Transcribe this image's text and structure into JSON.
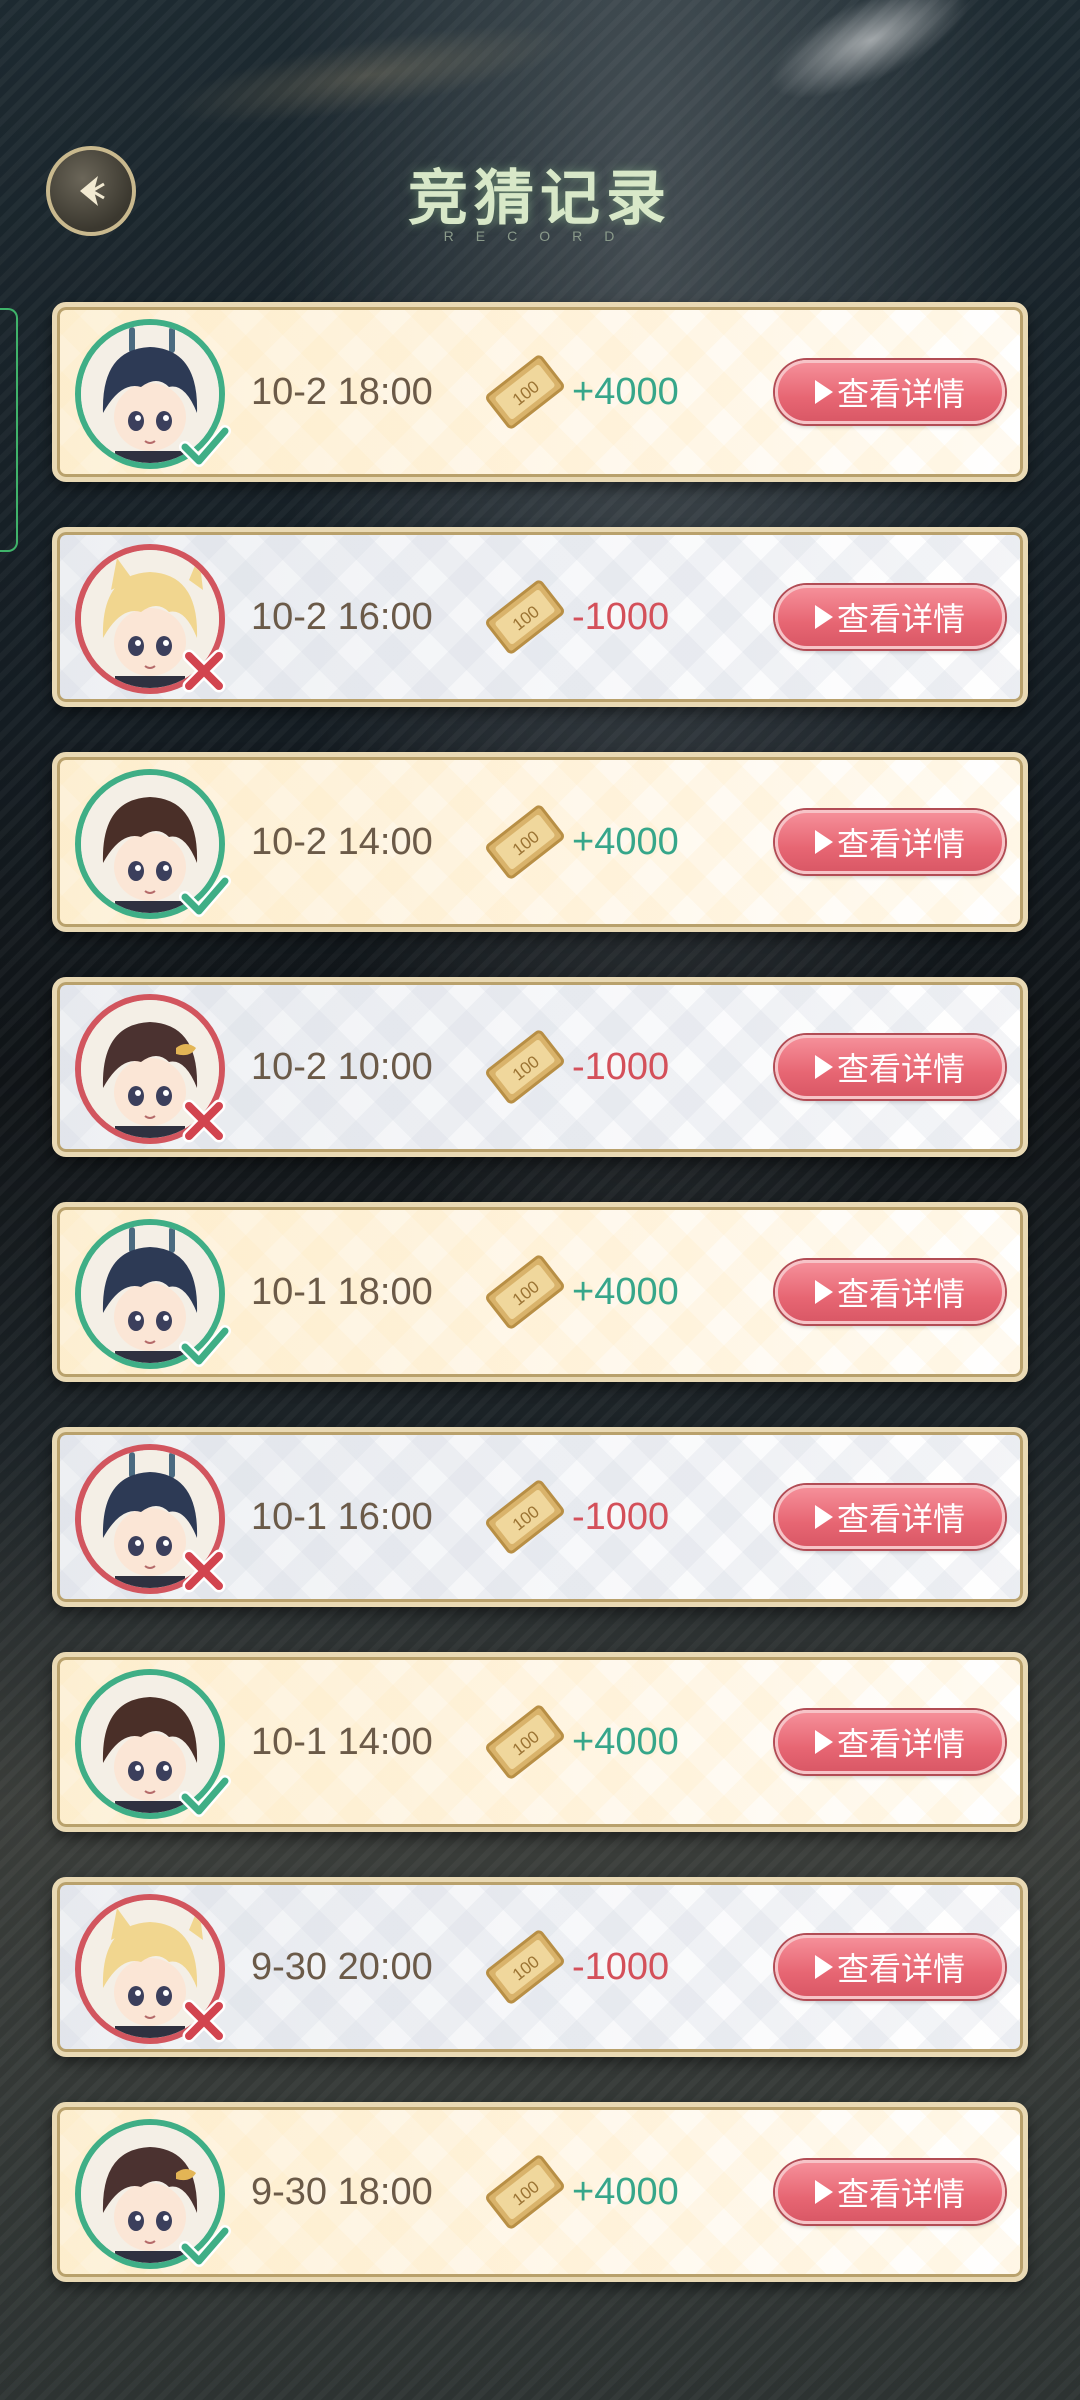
{
  "header": {
    "title": "竞猜记录",
    "subtitle": "RECORD"
  },
  "icons": {
    "back": "back-arrow-icon",
    "coin": "ticket-100-icon",
    "win": "checkmark-icon",
    "loss": "cross-icon"
  },
  "colors": {
    "win": "#36a68a",
    "loss": "#d4505a",
    "button": "#e76673"
  },
  "records": [
    {
      "time": "10-2 18:00",
      "amount": "+4000",
      "result": "win",
      "character": "dark-haired-boy",
      "button_label": "查看详情"
    },
    {
      "time": "10-2 16:00",
      "amount": "-1000",
      "result": "loss",
      "character": "blonde-catboy",
      "button_label": "查看详情"
    },
    {
      "time": "10-2 14:00",
      "amount": "+4000",
      "result": "win",
      "character": "brown-haired-boy",
      "button_label": "查看详情"
    },
    {
      "time": "10-2 10:00",
      "amount": "-1000",
      "result": "loss",
      "character": "brown-haired-boy-gold-ornament",
      "button_label": "查看详情"
    },
    {
      "time": "10-1 18:00",
      "amount": "+4000",
      "result": "win",
      "character": "dark-haired-boy",
      "button_label": "查看详情"
    },
    {
      "time": "10-1 16:00",
      "amount": "-1000",
      "result": "loss",
      "character": "dark-haired-boy",
      "button_label": "查看详情"
    },
    {
      "time": "10-1 14:00",
      "amount": "+4000",
      "result": "win",
      "character": "brown-haired-boy",
      "button_label": "查看详情"
    },
    {
      "time": "9-30 20:00",
      "amount": "-1000",
      "result": "loss",
      "character": "blonde-catboy",
      "button_label": "查看详情"
    },
    {
      "time": "9-30 18:00",
      "amount": "+4000",
      "result": "win",
      "character": "brown-haired-boy-gold-ornament",
      "button_label": "查看详情"
    }
  ]
}
